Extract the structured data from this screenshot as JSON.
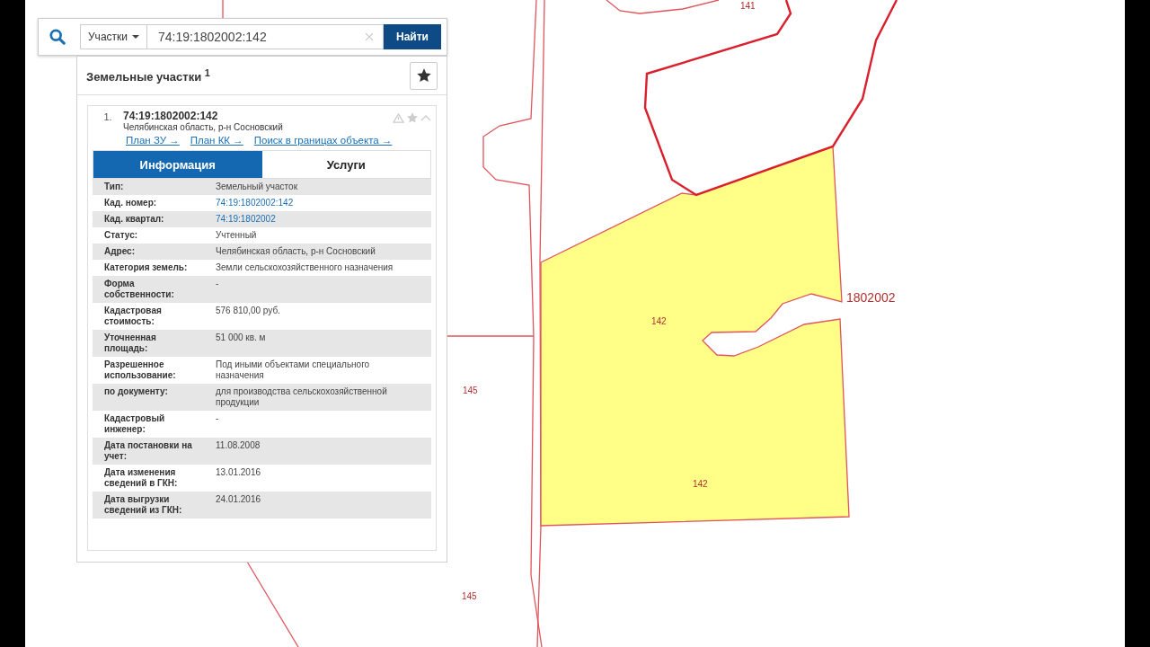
{
  "search": {
    "filter": "Участки",
    "value": "74:19:1802002:142",
    "button": "Найти"
  },
  "results": {
    "title": "Земельные участки $^{1}$"
  },
  "result": {
    "index": "1.",
    "number": "74:19:1802002:142",
    "address": "Челябинская область, р-н Сосновский",
    "links": [
      "План ЗУ →",
      "План КК →",
      "Поиск в границах объекта →"
    ]
  },
  "tabs": [
    {
      "label": "Информация",
      "selected": true
    },
    {
      "label": "Услуги",
      "selected": false
    }
  ],
  "info": [
    {
      "label": "Тип:",
      "value": "Земельный участок",
      "kind": "text"
    },
    {
      "label": "Кад. номер:",
      "value": "74:19:1802002:142",
      "kind": "link"
    },
    {
      "label": "Кад. квартал:",
      "value": "74:19:1802002",
      "kind": "link"
    },
    {
      "label": "Статус:",
      "value": "Учтенный",
      "kind": "text"
    },
    {
      "label": "Адрес:",
      "value": "Челябинская область, р-н Сосновский",
      "kind": "text"
    },
    {
      "label": "Категория земель:",
      "value": "Земли сельскохозяйственного назначения",
      "kind": "text"
    },
    {
      "label": "Форма собственности:",
      "value": "-",
      "kind": "text"
    },
    {
      "label": "Кадастровая стоимость:",
      "value": "576 810,00 руб.",
      "kind": "text"
    },
    {
      "label": "Уточненная площадь:",
      "value": "51 000 кв. м",
      "kind": "text"
    },
    {
      "label": "Разрешенное использование:",
      "value": "Под иными объектами специального назначения",
      "kind": "text"
    },
    {
      "label": "по документу:",
      "value": "для производства сельскохозяйственной продукции",
      "kind": "text"
    },
    {
      "label": "Кадастровый инженер:",
      "value": "-",
      "kind": "text"
    },
    {
      "label": "Дата постановки на учет:",
      "value": "11.08.2008",
      "kind": "text"
    },
    {
      "label": "Дата изменения сведений в ГКН:",
      "value": "13.01.2016",
      "kind": "text"
    },
    {
      "label": "Дата выгрузки сведений из ГКН:",
      "value": "24.01.2016",
      "kind": "text"
    }
  ],
  "map": {
    "labels": [
      {
        "text": "141",
        "kind": "parcel"
      },
      {
        "text": "1802002",
        "kind": "quarter"
      },
      {
        "text": "142",
        "kind": "parcel"
      },
      {
        "text": "142",
        "kind": "parcel"
      },
      {
        "text": "145",
        "kind": "parcel"
      },
      {
        "text": "145",
        "kind": "parcel"
      }
    ]
  }
}
